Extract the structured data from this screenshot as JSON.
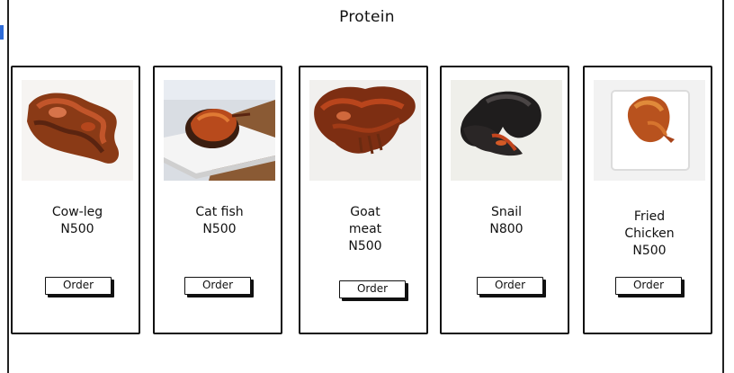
{
  "page": {
    "title": "Protein"
  },
  "colors": {
    "border": "#111111",
    "accent": "#2d6bd8"
  },
  "items": [
    {
      "name_lines": [
        "Cow-leg"
      ],
      "price": "N500",
      "button": "Order",
      "image": "cow-leg-photo"
    },
    {
      "name_lines": [
        "Cat fish"
      ],
      "price": "N500",
      "button": "Order",
      "image": "cat-fish-photo"
    },
    {
      "name_lines": [
        "Goat",
        "meat"
      ],
      "price": "N500",
      "button": "Order",
      "image": "goat-meat-photo"
    },
    {
      "name_lines": [
        "Snail"
      ],
      "price": "N800",
      "button": "Order",
      "image": "snail-photo"
    },
    {
      "name_lines": [
        "Fried",
        "Chicken"
      ],
      "price": "N500",
      "button": "Order",
      "image": "fried-chicken-photo"
    }
  ]
}
